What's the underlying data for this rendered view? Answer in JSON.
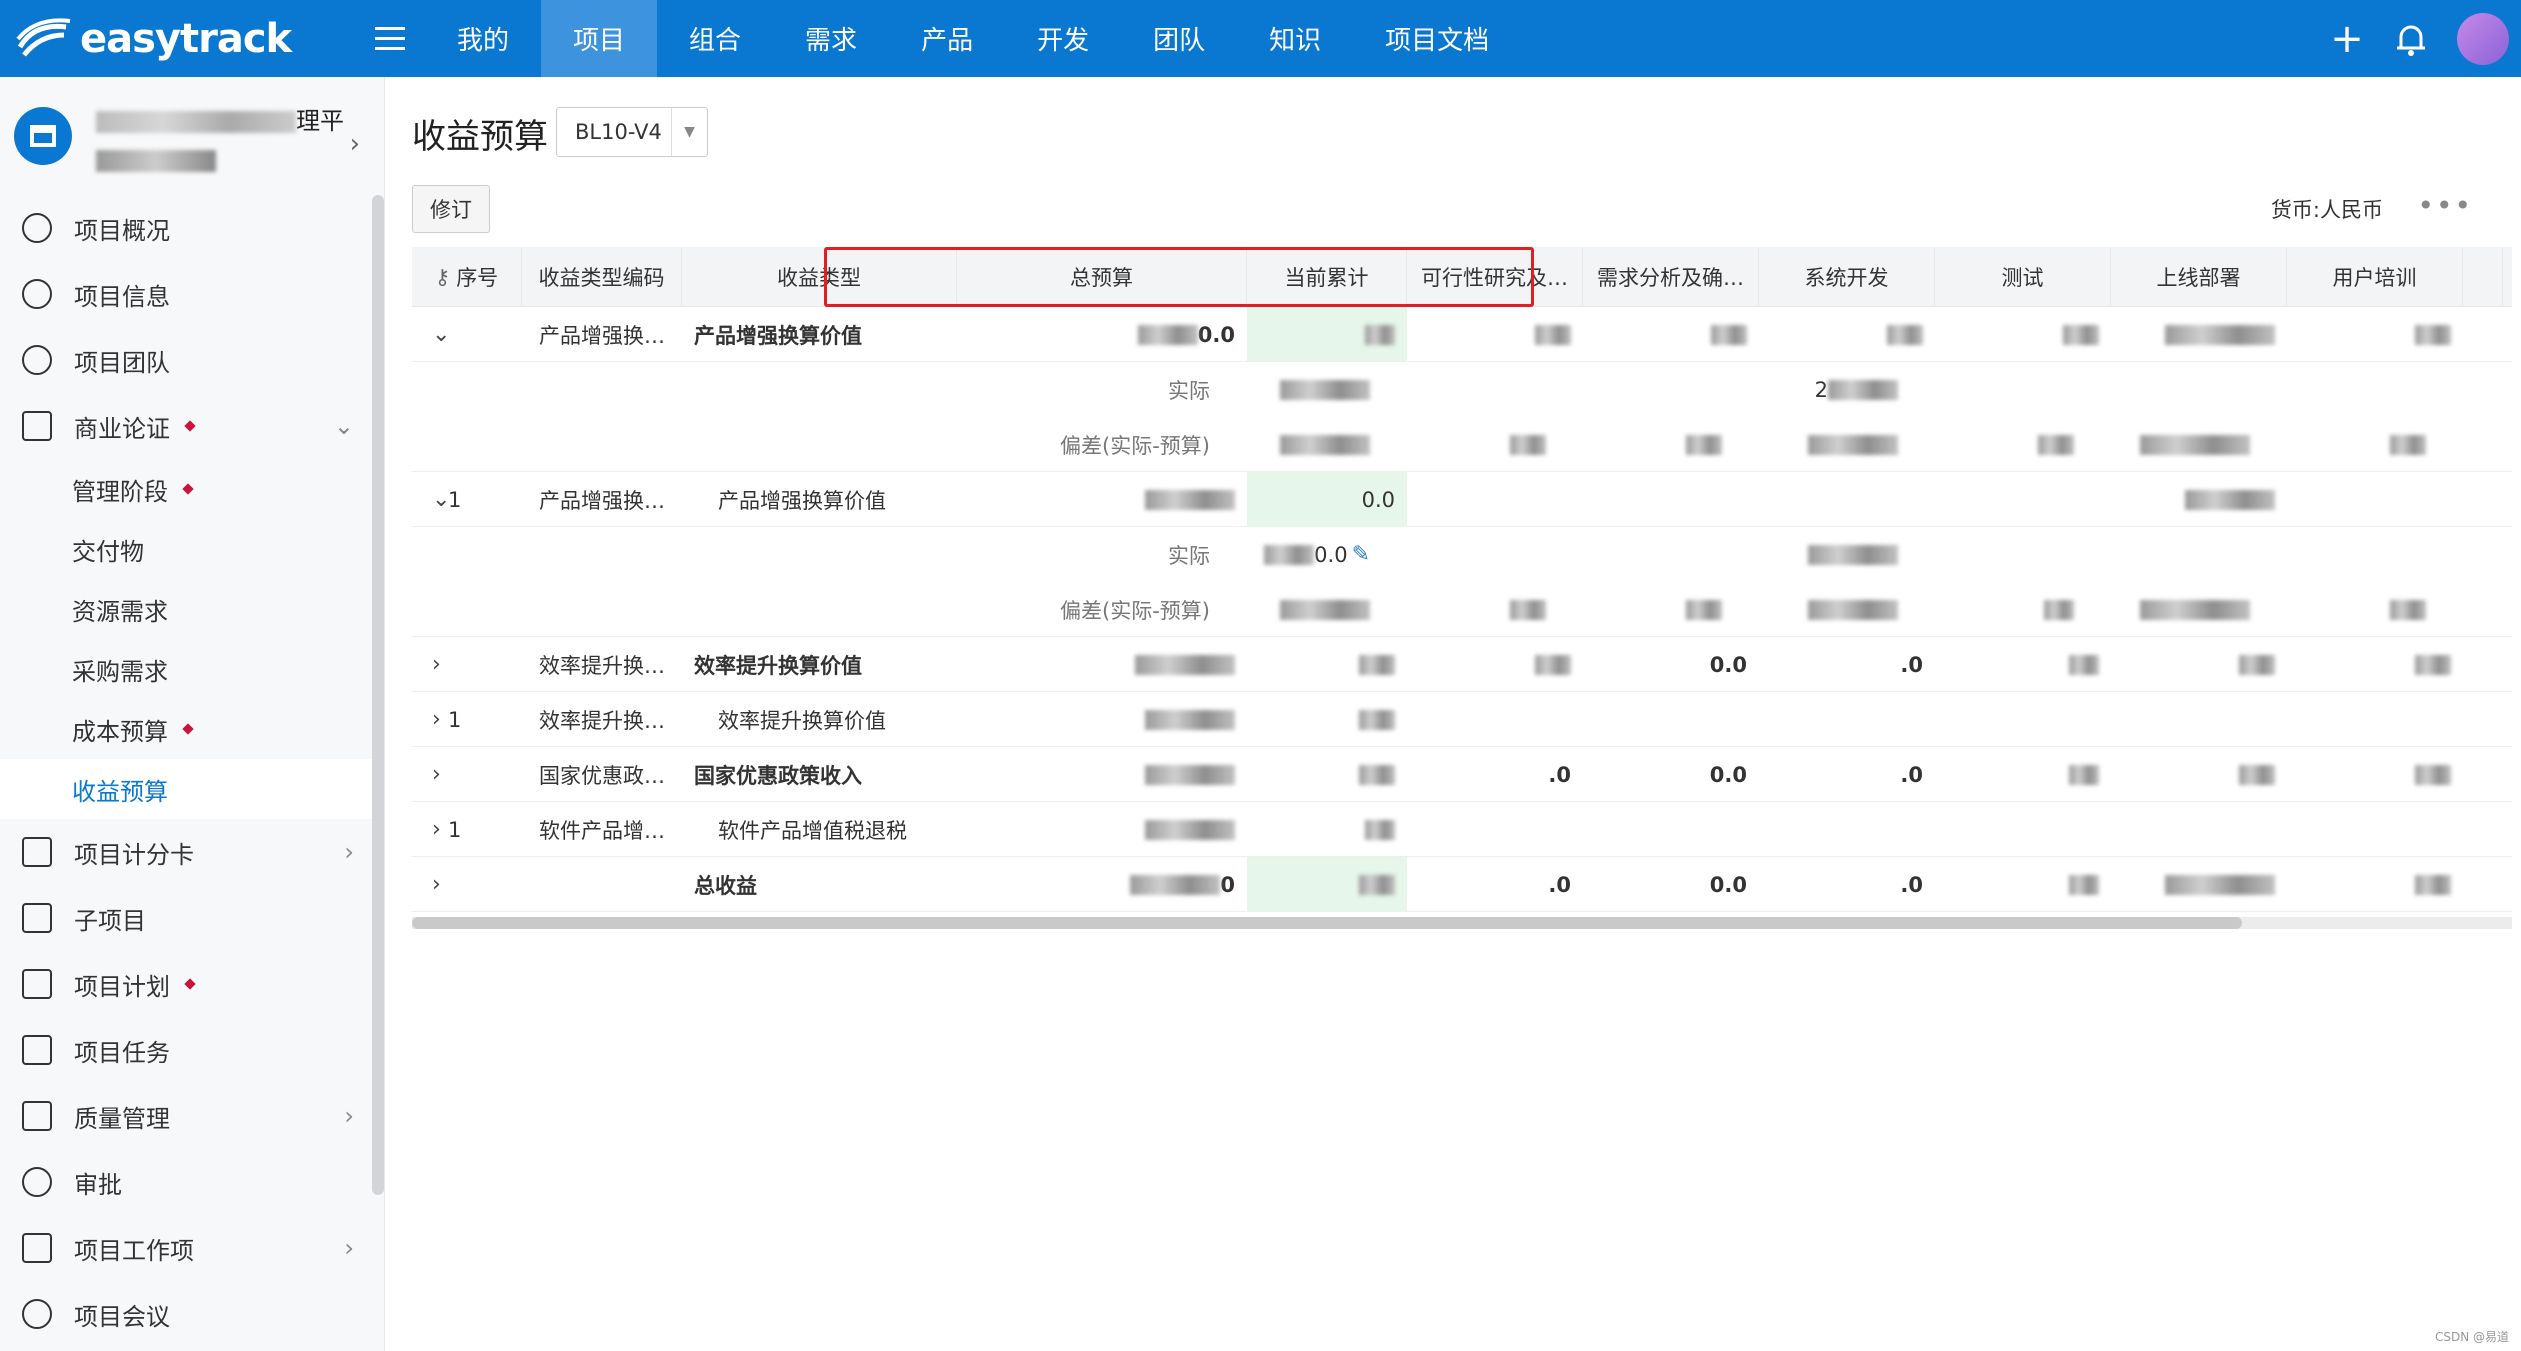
{
  "topbar": {
    "logo_text": "easytrack",
    "nav": [
      "我的",
      "项目",
      "组合",
      "需求",
      "产品",
      "开发",
      "团队",
      "知识",
      "项目文档"
    ],
    "active_nav": 1
  },
  "sidebar": {
    "project_suffix": "理平",
    "items": [
      {
        "label": "项目概况"
      },
      {
        "label": "项目信息"
      },
      {
        "label": "项目团队"
      },
      {
        "label": "商业论证"
      },
      {
        "label": "管理阶段"
      },
      {
        "label": "交付物"
      },
      {
        "label": "资源需求"
      },
      {
        "label": "采购需求"
      },
      {
        "label": "成本预算"
      },
      {
        "label": "收益预算"
      },
      {
        "label": "项目计分卡"
      },
      {
        "label": "子项目"
      },
      {
        "label": "项目计划"
      },
      {
        "label": "项目任务"
      },
      {
        "label": "质量管理"
      },
      {
        "label": "审批"
      },
      {
        "label": "项目工作项"
      },
      {
        "label": "项目会议"
      }
    ]
  },
  "page": {
    "title": "收益预算",
    "version": "BL10-V4",
    "revise_label": "修订",
    "currency": "货币:人民币",
    "more": "•••"
  },
  "table": {
    "headers": [
      "序号",
      "收益类型编码",
      "收益类型",
      "总预算",
      "当前累计",
      "可行性研究及…",
      "需求分析及确…",
      "系统开发",
      "测试",
      "上线部署",
      "用户培训"
    ],
    "rows": [
      {
        "seq": "",
        "code": "产品增强换…",
        "type": "产品增强换算价值",
        "total_suffix": "0.0",
        "cur": "",
        "bold": true,
        "vals": [
          "",
          "",
          "",
          "",
          "",
          ""
        ]
      },
      {
        "sub": "实际",
        "cur": "",
        "vals": [
          "",
          "",
          "2",
          "",
          "",
          ""
        ]
      },
      {
        "sub": "偏差(实际-预算)",
        "cur": "",
        "vals": [
          "",
          "",
          "",
          "",
          "",
          ""
        ]
      },
      {
        "seq": "1",
        "code": "产品增强换…",
        "type": "产品增强换算价值",
        "total_suffix": "",
        "cur": "0.0",
        "bold": false,
        "vals": [
          "",
          "",
          "",
          "",
          "",
          ""
        ]
      },
      {
        "sub": "实际",
        "cur": "0.0",
        "vals": [
          "",
          "",
          "",
          "",
          "",
          ""
        ]
      },
      {
        "sub": "偏差(实际-预算)",
        "cur": "",
        "vals": [
          "",
          "",
          "",
          "",
          "",
          ""
        ]
      },
      {
        "seq": "",
        "code": "效率提升换…",
        "type": "效率提升换算价值",
        "total_suffix": "",
        "cur": "",
        "bold": true,
        "vals": [
          "",
          "0.0",
          ".0",
          "",
          "",
          ""
        ]
      },
      {
        "seq": "1",
        "code": "效率提升换…",
        "type": "效率提升换算价值",
        "total_suffix": "",
        "cur": "",
        "bold": false,
        "vals": [
          "",
          "",
          "",
          "",
          "",
          ""
        ]
      },
      {
        "seq": "",
        "code": "国家优惠政…",
        "type": "国家优惠政策收入",
        "total_suffix": "",
        "cur": "",
        "bold": true,
        "vals": [
          ".0",
          "0.0",
          ".0",
          "",
          "",
          ""
        ]
      },
      {
        "seq": "1",
        "code": "软件产品增…",
        "type": "软件产品增值税退税",
        "total_suffix": "",
        "cur": "",
        "bold": false,
        "vals": [
          "",
          "",
          "",
          "",
          "",
          ""
        ]
      },
      {
        "seq": "",
        "code": "",
        "type": "总收益",
        "total_suffix": "0",
        "cur": "",
        "bold": true,
        "vals": [
          ".0",
          "0.0",
          ".0",
          "",
          "",
          ""
        ]
      }
    ]
  },
  "watermark": "CSDN @易道"
}
